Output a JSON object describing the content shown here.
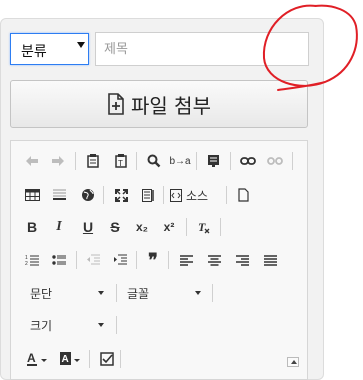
{
  "category_select": {
    "value": "분류"
  },
  "title_input": {
    "placeholder": "제목"
  },
  "attach_button": {
    "label": "파일 첨부"
  },
  "toolbar": {
    "source_label": "소스",
    "format_combo": "문단",
    "font_combo": "글꼴",
    "size_combo": "크기",
    "bold": "B",
    "italic": "I",
    "underline": "U",
    "strike": "S",
    "subscript": "x₂",
    "superscript": "x²",
    "blockquote": "❞",
    "replace": "b→a"
  },
  "colors": {
    "focus_border": "#2d7df2",
    "annotation_red": "#e01f26"
  }
}
